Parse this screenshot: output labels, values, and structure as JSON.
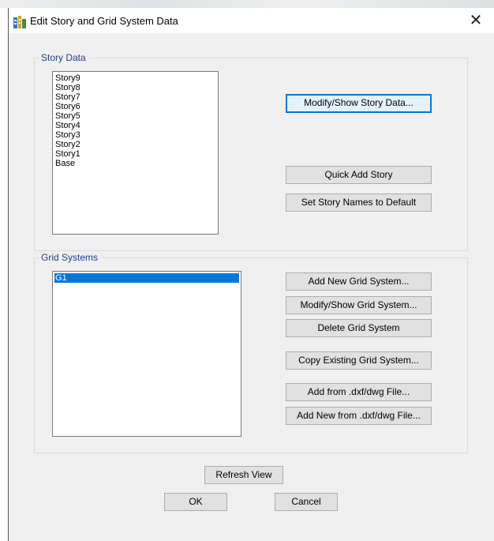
{
  "window": {
    "title": "Edit Story and Grid System Data",
    "close_glyph": "✕"
  },
  "story_data": {
    "group_label": "Story Data",
    "stories": [
      "Story9",
      "Story8",
      "Story7",
      "Story6",
      "Story5",
      "Story4",
      "Story3",
      "Story2",
      "Story1",
      "Base"
    ],
    "buttons": {
      "modify": "Modify/Show Story Data...",
      "quick_add": "Quick Add Story",
      "set_default": "Set Story Names to Default"
    }
  },
  "grid_systems": {
    "group_label": "Grid Systems",
    "items": [
      "G1"
    ],
    "selected_item": "G1",
    "buttons": {
      "add_new": "Add New Grid System...",
      "modify": "Modify/Show Grid System...",
      "delete": "Delete Grid System",
      "copy": "Copy Existing Grid System...",
      "add_dxf": "Add  from .dxf/dwg File...",
      "add_new_dxf": "Add New from .dxf/dwg File..."
    }
  },
  "footer": {
    "refresh": "Refresh View",
    "ok": "OK",
    "cancel": "Cancel"
  },
  "colors": {
    "group_label": "#1c3f94",
    "selection": "#0078d7",
    "dialog_bg": "#f0f0f0"
  },
  "icons": {
    "app": "etabs-app-icon",
    "close": "close-icon"
  }
}
